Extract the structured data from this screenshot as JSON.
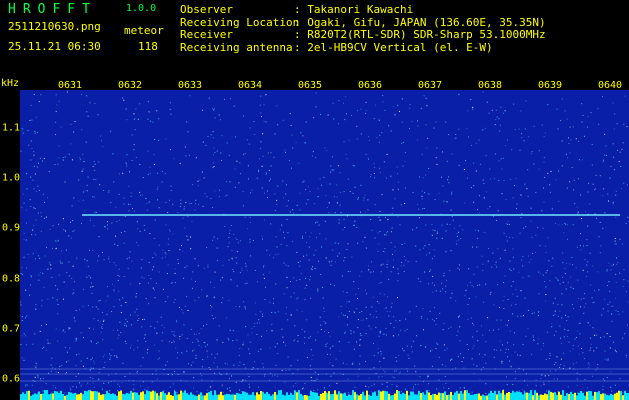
{
  "header": {
    "app_title": "HROFFT",
    "app_version": "1.0.0",
    "filename": "2511210630.png",
    "datetime": "25.11.21 06:30",
    "mode_label": "meteor",
    "count": "118",
    "info": [
      {
        "key": "Observer",
        "value": ": Takanori Kawachi"
      },
      {
        "key": "Receiving Location",
        "value": ": Ogaki, Gifu, JAPAN (136.60E, 35.35N)"
      },
      {
        "key": "Receiver",
        "value": ": R820T2(RTL-SDR) SDR-Sharp 53.1000MHz"
      },
      {
        "key": "Receiving antenna",
        "value": ": 2el-HB9CV Vertical (el. E-W)"
      }
    ]
  },
  "plot": {
    "unit_label": "kHz",
    "time_ticks": [
      "0631",
      "0632",
      "0633",
      "0634",
      "0635",
      "0636",
      "0637",
      "0638",
      "0639",
      "0640"
    ],
    "freq_ticks": [
      "1.1",
      "1.0",
      "0.9",
      "0.8",
      "0.7",
      "0.6"
    ],
    "colors": {
      "background": "#0a1fa8",
      "speckle": "#5fd0ff",
      "carrier": "#6fe8ff",
      "tick": "#ffff00",
      "header_accent": "#00ff3c"
    }
  }
}
